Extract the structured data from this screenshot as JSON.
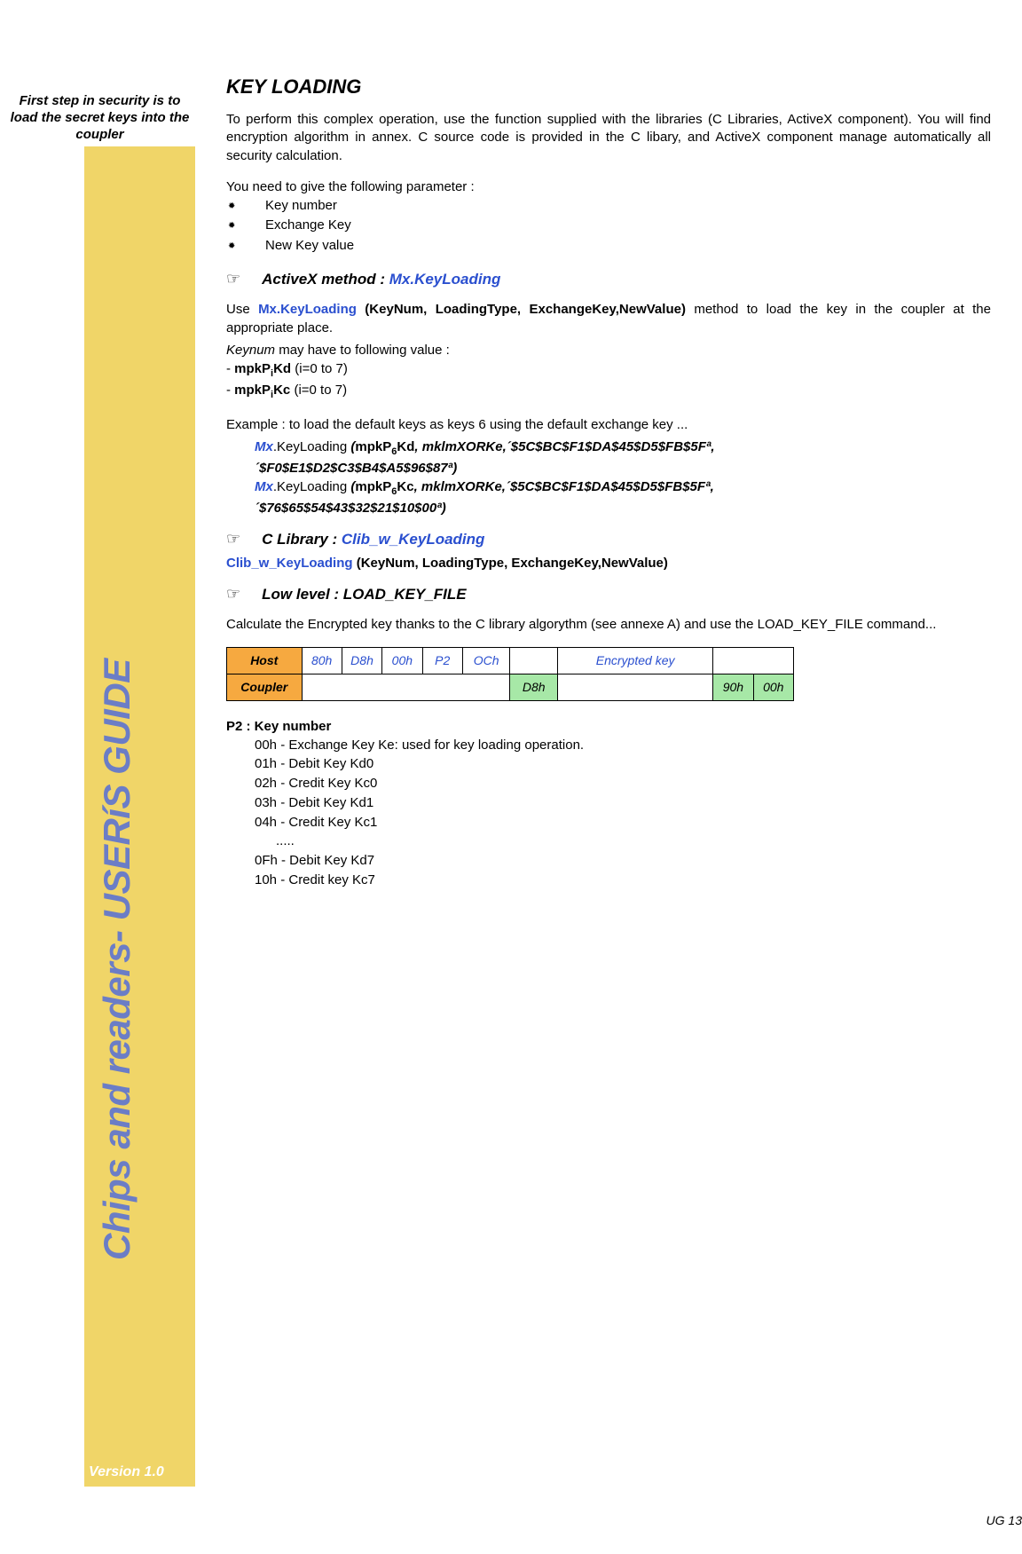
{
  "sidebar": {
    "note": "First step in security is to load the secret keys into the coupler",
    "vertical_title": "Chips and readers- USERíS GUIDE",
    "version": "Version 1.0"
  },
  "footer": {
    "page": "UG 13"
  },
  "main": {
    "h1": "KEY LOADING",
    "intro1": "To perform this complex operation, use the function supplied with the libraries (C Libraries, ActiveX component). You will find encryption algorithm in annex. C source code is provided in the C libary, and ActiveX component manage automatically all security calculation.",
    "intro2": "You need to give the following parameter :",
    "bullets": [
      "Key number",
      "Exchange Key",
      "New Key value"
    ],
    "activex": {
      "label_prefix": "ActiveX method : ",
      "method": "Mx.KeyLoading",
      "use_prefix": "Use ",
      "use_method": "Mx.KeyLoading",
      "use_sig": " (KeyNum, LoadingType, ExchangeKey,NewValue)",
      "use_suffix": " method to load the key in the coupler at the appropriate place.",
      "keynum_line_prefix_italic": "Keynum",
      "keynum_line_suffix": " may have to following value :",
      "kd_line_prefix": "- ",
      "kd_code": "mpkP",
      "kd_sub": "i",
      "kd_tail": "Kd",
      "kd_range": " (i=0 to 7)",
      "kc_tail": "Kc",
      "example_line": "Example : to load the default keys as keys 6 using the default exchange key ...",
      "code1_mx": "Mx",
      "code1_rest": ".KeyLoading ",
      "code1_open": "(",
      "code1_arg1": "mpkP",
      "code1_sub": "6",
      "code1_kd": "Kd",
      "code1_tail": ", mklmXORKe,´$5C$BC$F1$DA$45$D5$FB$5Fª,",
      "code1_line2": "´$F0$E1$D2$C3$B4$A5$96$87ª)",
      "code2_kc": "Kc",
      "code2_tail": ", mklmXORKe,´$5C$BC$F1$DA$45$D5$FB$5Fª,",
      "code2_line2": "´$76$65$54$43$32$21$10$00ª)"
    },
    "clib": {
      "label_prefix": "C Library : ",
      "method": "Clib_w_KeyLoading",
      "sig_name": "Clib_w_KeyLoading",
      "sig_args": " (KeyNum, LoadingType, ExchangeKey,NewValue)"
    },
    "lowlevel": {
      "label": "Low level : LOAD_KEY_FILE",
      "desc": "Calculate the Encrypted key thanks to the C library algorythm (see annexe A) and use the LOAD_KEY_FILE command..."
    },
    "table": {
      "host": "Host",
      "coupler": "Coupler",
      "row1": [
        "80h",
        "D8h",
        "00h",
        "P2",
        "OCh",
        "",
        "Encrypted key",
        ""
      ],
      "row2_d8h": "D8h",
      "row2_90h": "90h",
      "row2_00h": "00h"
    },
    "p2": {
      "title": "P2 : Key number",
      "lines": [
        "00h - Exchange Key Ke: used for key loading operation.",
        "01h - Debit Key Kd0",
        "02h - Credit Key Kc0",
        "03h - Debit Key Kd1",
        "04h - Credit Key Kc1"
      ],
      "dots": ".....",
      "lines2": [
        "0Fh - Debit Key Kd7",
        "10h - Credit key Kc7"
      ]
    }
  }
}
